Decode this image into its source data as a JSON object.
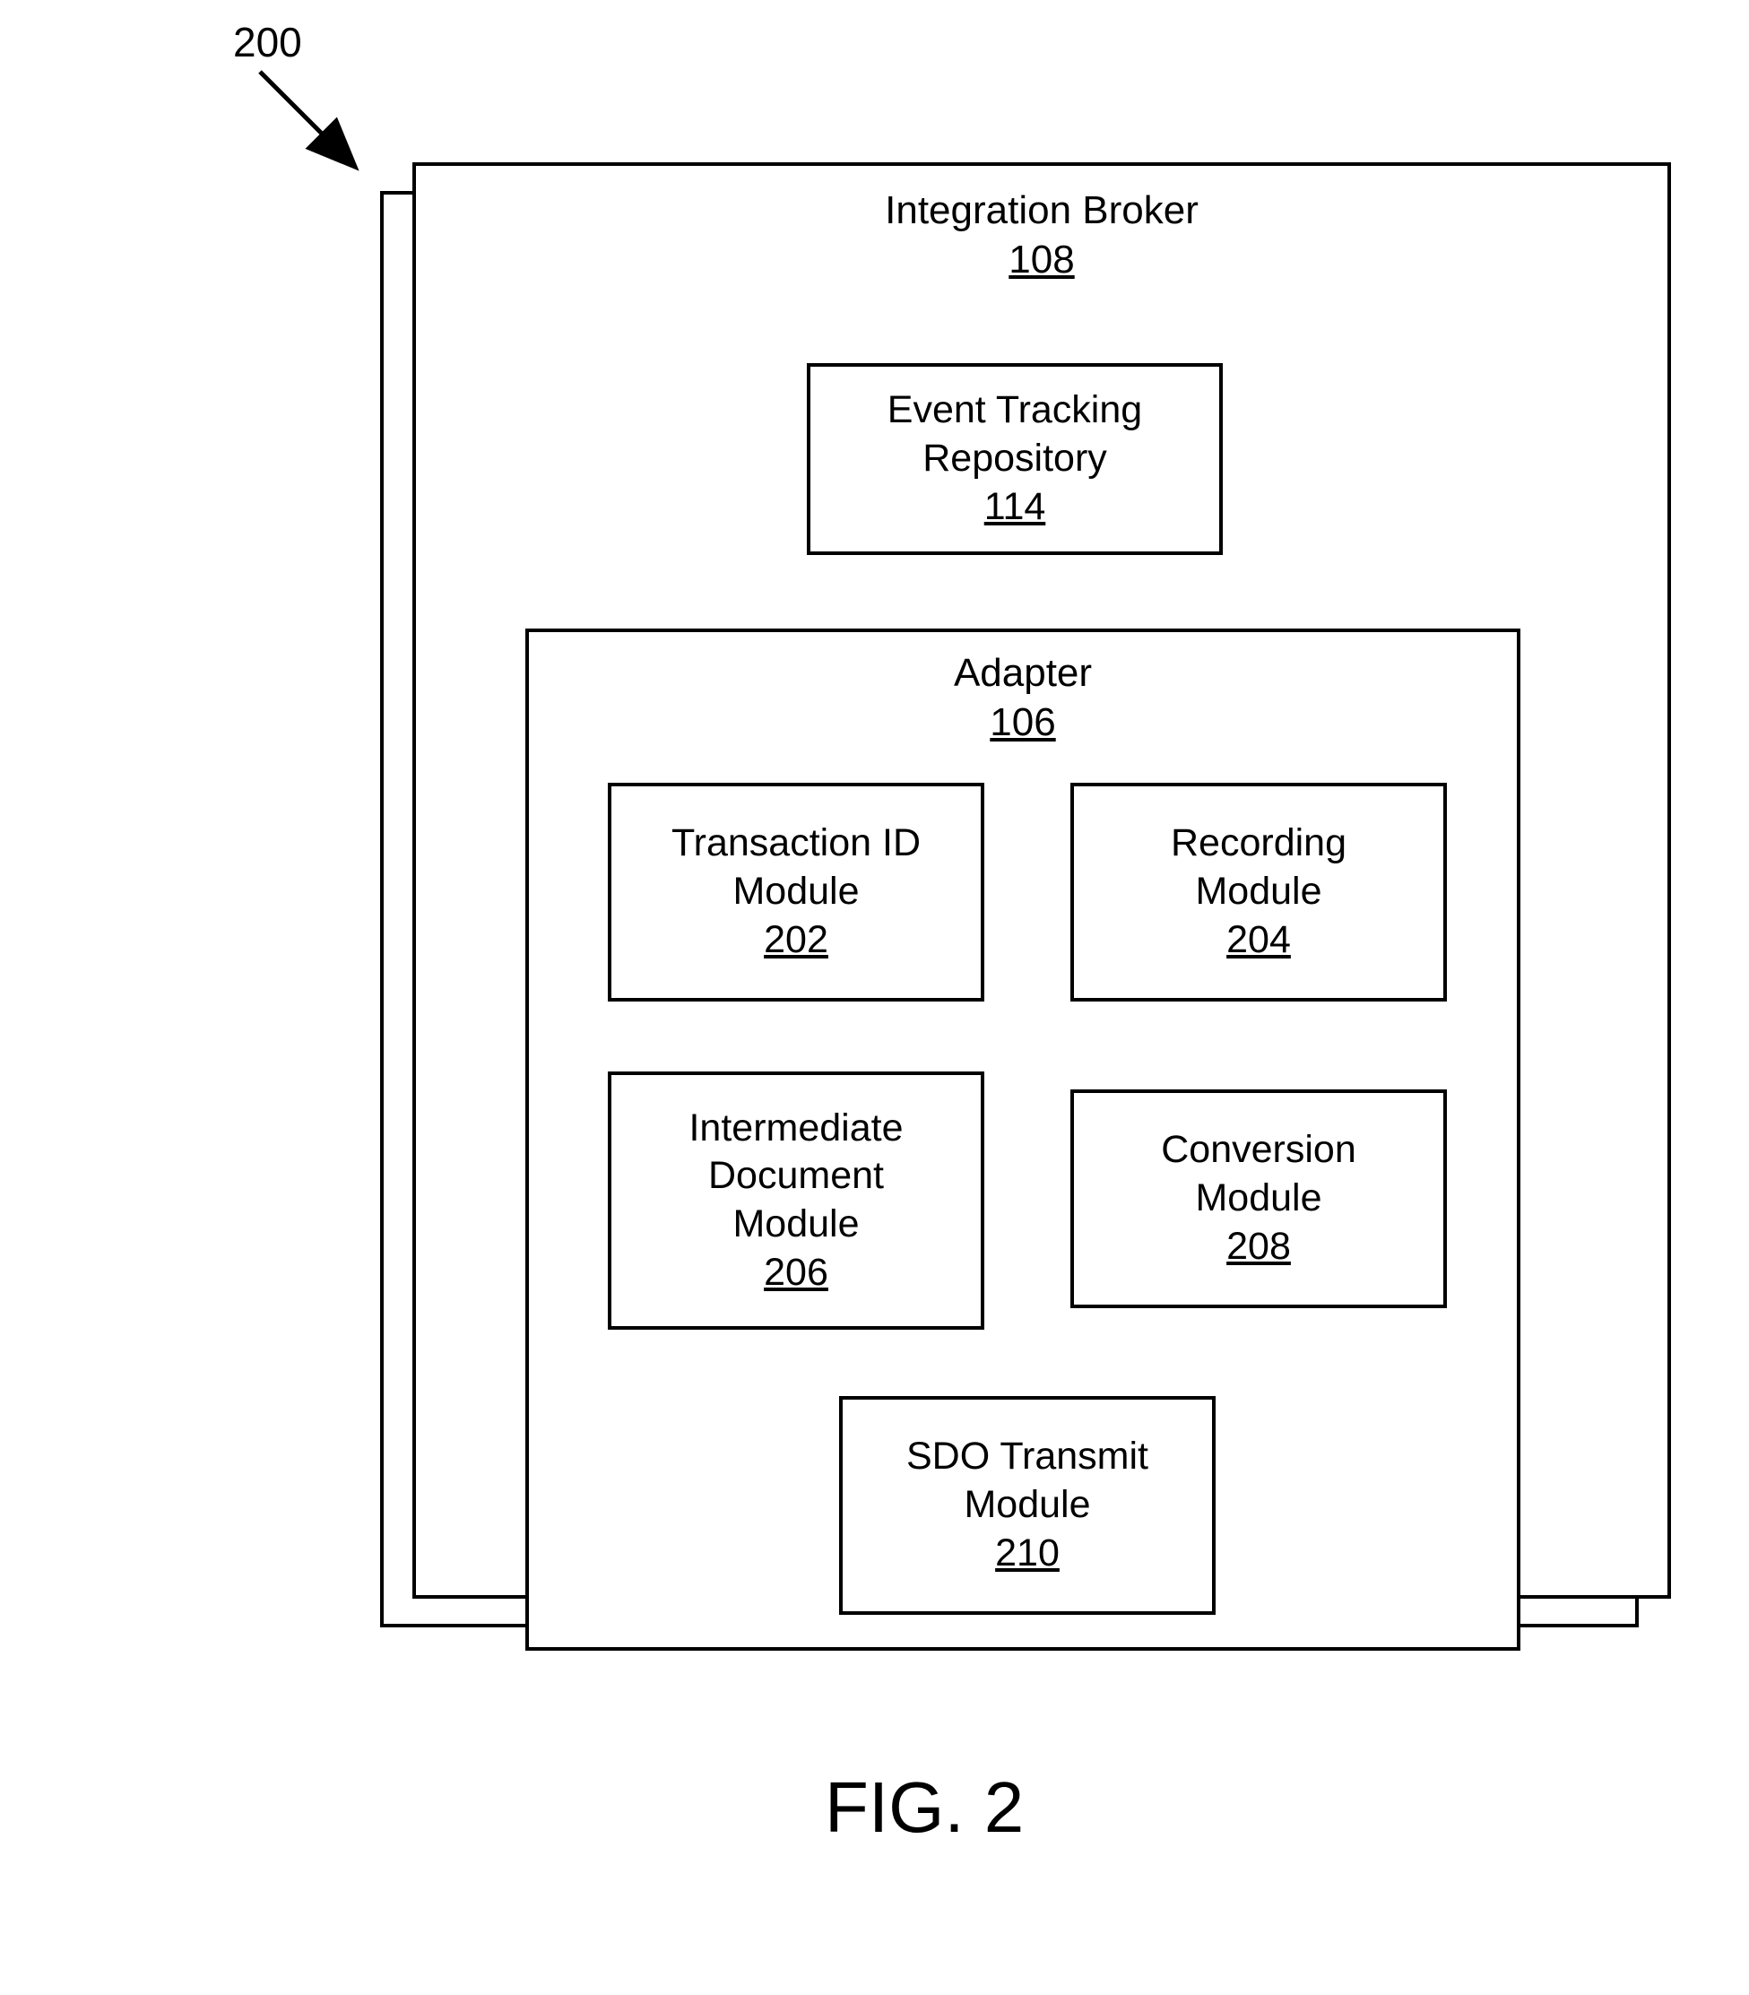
{
  "callout": "200",
  "broker": {
    "title": "Integration Broker",
    "ref": "108",
    "repo": {
      "line1": "Event Tracking",
      "line2": "Repository",
      "ref": "114"
    },
    "adapter": {
      "title": "Adapter",
      "ref": "106",
      "modules": {
        "tid": {
          "line1": "Transaction ID",
          "line2": "Module",
          "ref": "202"
        },
        "rec": {
          "line1": "Recording",
          "line2": "Module",
          "ref": "204"
        },
        "idoc": {
          "line1": "Intermediate",
          "line2": "Document",
          "line3": "Module",
          "ref": "206"
        },
        "conv": {
          "line1": "Conversion",
          "line2": "Module",
          "ref": "208"
        },
        "sdo": {
          "line1": "SDO Transmit",
          "line2": "Module",
          "ref": "210"
        }
      }
    }
  },
  "figure": "FIG. 2"
}
